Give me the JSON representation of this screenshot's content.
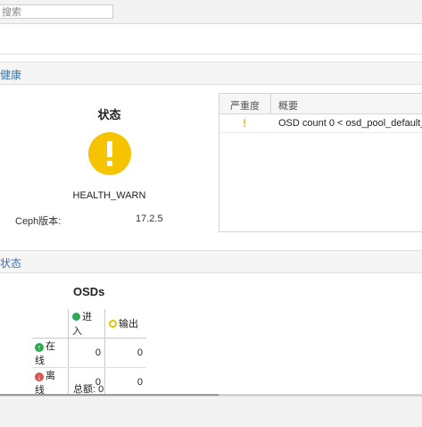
{
  "search": {
    "placeholder": "搜索"
  },
  "health_panel": {
    "header": "健康",
    "status_title": "状态",
    "status_icon": "warning-icon",
    "status_text": "HEALTH_WARN",
    "version_label": "Ceph版本:",
    "version_value": "17.2.5",
    "grid": {
      "columns": [
        "严重度",
        "概要"
      ],
      "rows": [
        {
          "severity": "!",
          "summary": "OSD count 0 < osd_pool_default_"
        }
      ]
    }
  },
  "status_panel": {
    "header": "状态",
    "osds_title": "OSDs",
    "columns": {
      "in": "进入",
      "out": "输出"
    },
    "rows": [
      {
        "label": "在线",
        "in": "0",
        "out": "0"
      },
      {
        "label": "离线",
        "in": "0",
        "out": "0"
      }
    ],
    "total": "总额: 0"
  },
  "colors": {
    "accent": "#3c73a8",
    "warning": "#f6c300",
    "ok": "#2daa4f",
    "error": "#d9534f"
  }
}
